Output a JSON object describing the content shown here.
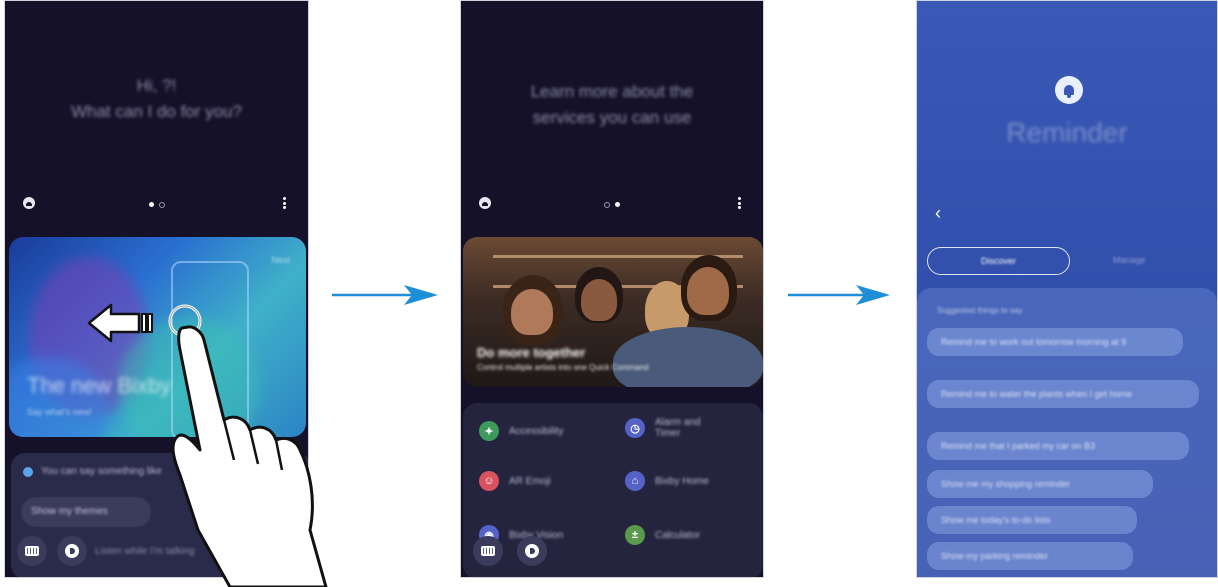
{
  "screen1": {
    "greeting_line1": "Hi, ?!",
    "greeting_line2": "What can I do for you?",
    "card": {
      "next_label": "Next",
      "title": "The new Bixby",
      "subtitle": "Say what's new!"
    },
    "suggestion_text": "You can say something like",
    "chip_label": "Show my themes",
    "input_hint": "Listen while I'm talking"
  },
  "screen2": {
    "greeting_line1": "Learn more about the",
    "greeting_line2": "services you can use",
    "photo_title": "Do more together",
    "photo_subtitle": "Control multiple artists into one Quick Command",
    "services": [
      {
        "label": "Accessibility",
        "icon": "accessibility-icon",
        "color": "#3d9a5a",
        "glyph": "✦"
      },
      {
        "label": "Alarm and Timer",
        "icon": "clock-icon",
        "color": "#5563c8",
        "glyph": "◷"
      },
      {
        "label": "AR Emoji",
        "icon": "emoji-icon",
        "color": "#d9525f",
        "glyph": "☺"
      },
      {
        "label": "Bixby Home",
        "icon": "bixby-home-icon",
        "color": "#5563c8",
        "glyph": "⌂"
      },
      {
        "label": "Bixby Vision",
        "icon": "vision-icon",
        "color": "#5563c8",
        "glyph": "◉"
      },
      {
        "label": "Calculator",
        "icon": "calculator-icon",
        "color": "#5a9a4a",
        "glyph": "±"
      }
    ]
  },
  "screen3": {
    "title": "Reminder",
    "tab_discover": "Discover",
    "tab_manage": "Manage",
    "suggestions_heading": "Suggested things to say",
    "suggestions": [
      "Remind me to work out tomorrow morning at 9",
      "Remind me to water the plants when I get home",
      "Remind me that I parked my car on B3",
      "Show me my shopping reminder",
      "Show me today's to-do lists",
      "Show my parking reminder"
    ]
  }
}
